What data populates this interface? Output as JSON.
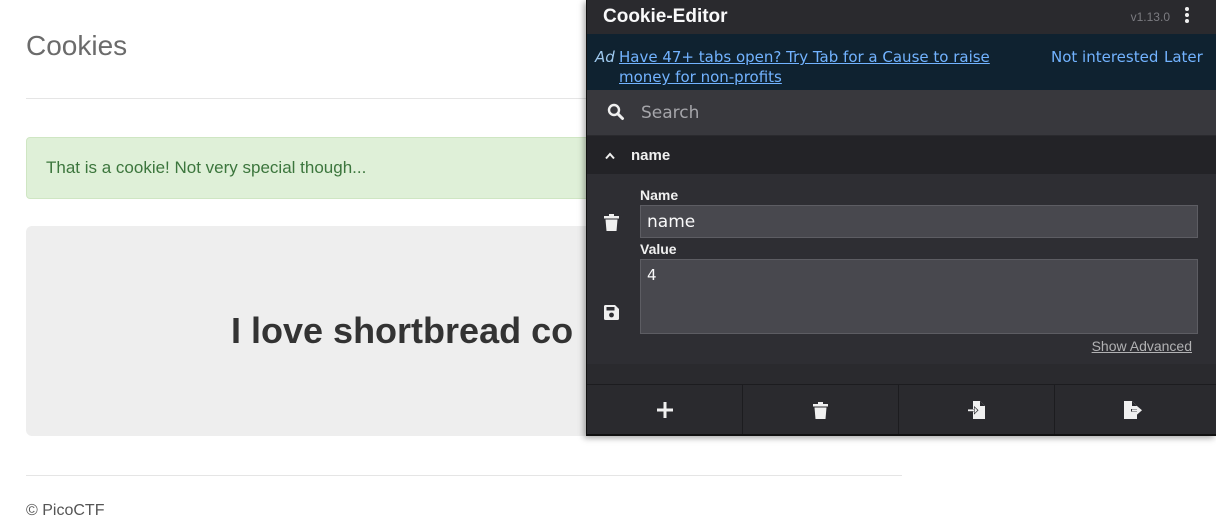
{
  "page": {
    "title": "Cookies",
    "alert": "That is a cookie! Not very special though...",
    "headline": "I love shortbread co",
    "footer": "© PicoCTF"
  },
  "extension": {
    "title": "Cookie-Editor",
    "version": "v1.13.0",
    "menu_icon": "kebab-menu-icon",
    "ad": {
      "tag": "Ad",
      "text": "Have 47+ tabs open? Try Tab for a Cause to raise money for non-profits",
      "not_interested": "Not interested",
      "later": "Later"
    },
    "search": {
      "placeholder": "Search",
      "value": ""
    },
    "cookie": {
      "header_name": "name",
      "name_label": "Name",
      "name_value": "name",
      "value_label": "Value",
      "value_value": "4",
      "show_advanced": "Show Advanced"
    },
    "toolbar": [
      "plus-icon",
      "trash-icon",
      "import-icon",
      "export-icon"
    ]
  },
  "colors": {
    "alert_bg": "#dff0d8",
    "alert_text": "#3c763d",
    "popup_bg": "#2a2a2e",
    "ad_bg": "#0f2230",
    "link": "#72b3ff"
  }
}
